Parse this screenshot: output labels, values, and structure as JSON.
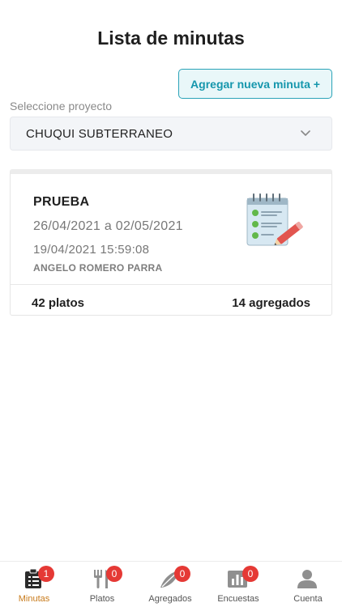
{
  "header": {
    "title": "Lista de minutas"
  },
  "actions": {
    "add_label": "Agregar nueva minuta +"
  },
  "project": {
    "label": "Seleccione proyecto",
    "selected": "CHUQUI SUBTERRANEO"
  },
  "minutas": [
    {
      "name": "PRUEBA",
      "date_range": "26/04/2021 a 02/05/2021",
      "created": "19/04/2021 15:59:08",
      "author": "ANGELO ROMERO PARRA",
      "platos": "42 platos",
      "agregados": "14 agregados",
      "icon": "checklist-notepad-icon"
    }
  ],
  "bottom_nav": [
    {
      "label": "Minutas",
      "badge": "1",
      "icon": "clipboard-list-icon",
      "active": true
    },
    {
      "label": "Platos",
      "badge": "0",
      "icon": "fork-knife-icon"
    },
    {
      "label": "Agregados",
      "badge": "0",
      "icon": "leaf-icon"
    },
    {
      "label": "Encuestas",
      "badge": "0",
      "icon": "bar-chart-icon"
    },
    {
      "label": "Cuenta",
      "badge": "",
      "icon": "user-icon"
    }
  ],
  "colors": {
    "accent": "#1697ad",
    "active_tab": "#c87a1a",
    "badge": "#e53935"
  }
}
